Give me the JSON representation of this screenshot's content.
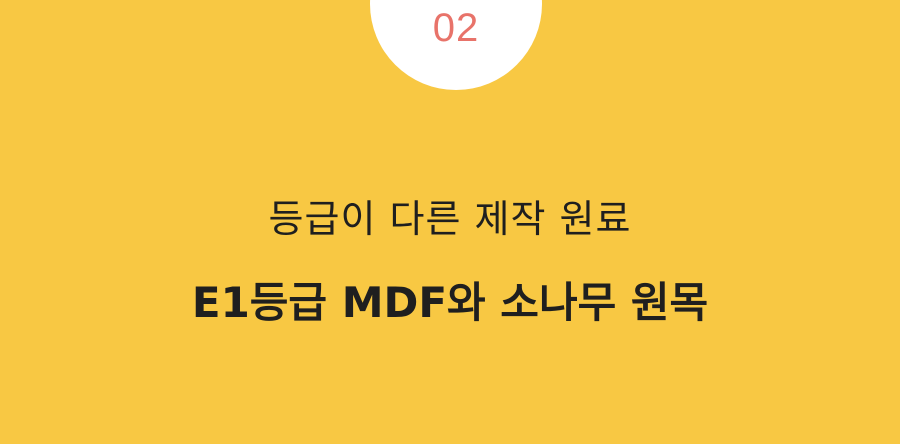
{
  "badge": {
    "number": "02"
  },
  "headline": {
    "line1": "등급이 다른 제작 원료",
    "line2": "E1등급 MDF와 소나무 원목"
  },
  "colors": {
    "background": "#f8c843",
    "badge": "#ffffff",
    "number": "#e8736a",
    "text": "#1f1f1f"
  }
}
